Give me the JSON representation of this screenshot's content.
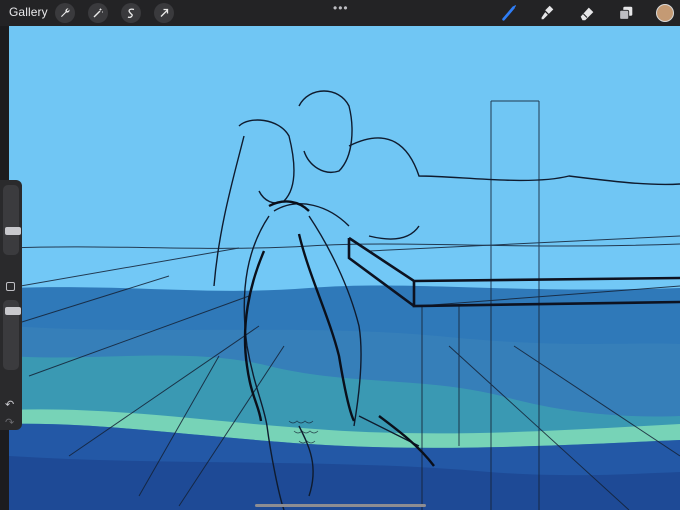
{
  "topbar": {
    "gallery_label": "Gallery",
    "more_glyph": "•••",
    "left_tools": [
      "wrench-icon",
      "magic-wand-icon",
      "selection-icon",
      "transform-arrow-icon"
    ],
    "right_tools": [
      "brush-icon",
      "smudge-icon",
      "eraser-icon",
      "layers-icon"
    ],
    "active_tool": "brush-icon",
    "active_color": "#c49a74",
    "accent": "#2f7ef7"
  },
  "sidebar": {
    "modify_button": "square",
    "undo_glyph": "↶",
    "redo_glyph": "↷"
  },
  "canvas": {
    "sky_color": "#6fc6f4",
    "water_colors": [
      "#2f77b8",
      "#3d9db1",
      "#73d0b6",
      "#1f4d98"
    ]
  }
}
